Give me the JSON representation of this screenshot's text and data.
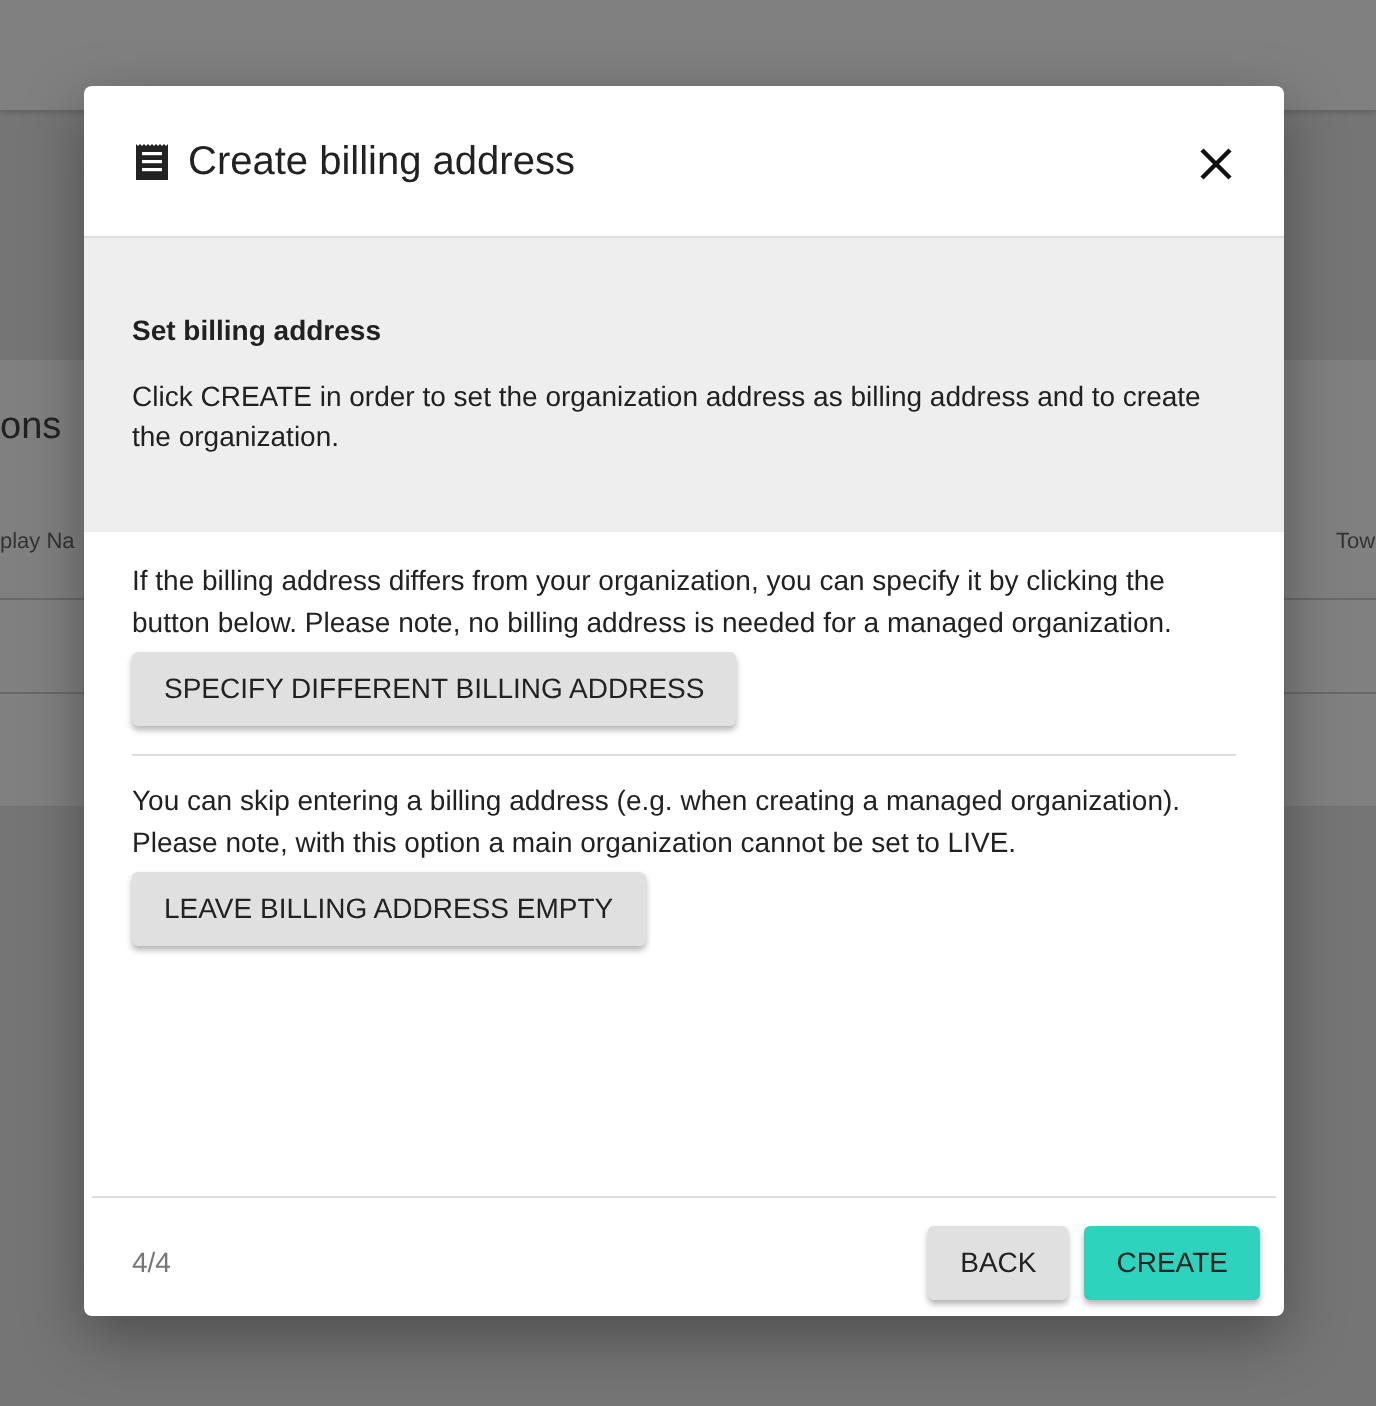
{
  "background": {
    "card_title": "ons",
    "columns": [
      {
        "label": "play Na"
      },
      {
        "label": "Tow"
      }
    ]
  },
  "dialog": {
    "title": "Create billing address",
    "info": {
      "heading": "Set billing address",
      "text": "Click CREATE in order to set the organization address as billing address and to create the organization."
    },
    "options": [
      {
        "text": "If the billing address differs from your organization, you can specify it by clicking the button below. Please note, no billing address is needed for a managed organization.",
        "button": "SPECIFY DIFFERENT BILLING ADDRESS"
      },
      {
        "text": "You can skip entering a billing address (e.g. when creating a managed organization). Please note, with this option a main organization cannot be set to LIVE.",
        "button": "LEAVE BILLING ADDRESS EMPTY"
      }
    ],
    "step": "4/4",
    "buttons": [
      {
        "label": "BACK",
        "kind": "secondary"
      },
      {
        "label": "CREATE",
        "kind": "primary"
      }
    ]
  }
}
